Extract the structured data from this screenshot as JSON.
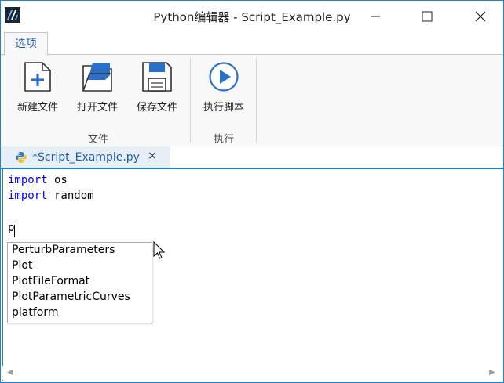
{
  "window": {
    "title": "Python编辑器 - Script_Example.py",
    "accent_color": "#1883d7"
  },
  "ribbon": {
    "tabs": [
      {
        "label": "选项",
        "selected": true
      }
    ],
    "groups": [
      {
        "label": "文件",
        "buttons": [
          {
            "label": "新建文件",
            "icon": "new-file-icon"
          },
          {
            "label": "打开文件",
            "icon": "open-file-icon"
          },
          {
            "label": "保存文件",
            "icon": "save-file-icon"
          }
        ]
      },
      {
        "label": "执行",
        "buttons": [
          {
            "label": "执行脚本",
            "icon": "run-icon"
          }
        ]
      }
    ]
  },
  "document_tabs": [
    {
      "label": "*Script_Example.py",
      "icon": "python-icon",
      "close": "×",
      "active": true
    }
  ],
  "editor": {
    "lines": [
      {
        "keyword": "import",
        "rest": " os"
      },
      {
        "keyword": "import",
        "rest": " random"
      },
      {
        "keyword": "",
        "rest": ""
      },
      {
        "keyword": "",
        "rest": "p"
      }
    ],
    "autocomplete": {
      "items": [
        "PerturbParameters",
        "Plot",
        "PlotFileFormat",
        "PlotParametricCurves",
        "platform"
      ]
    }
  }
}
